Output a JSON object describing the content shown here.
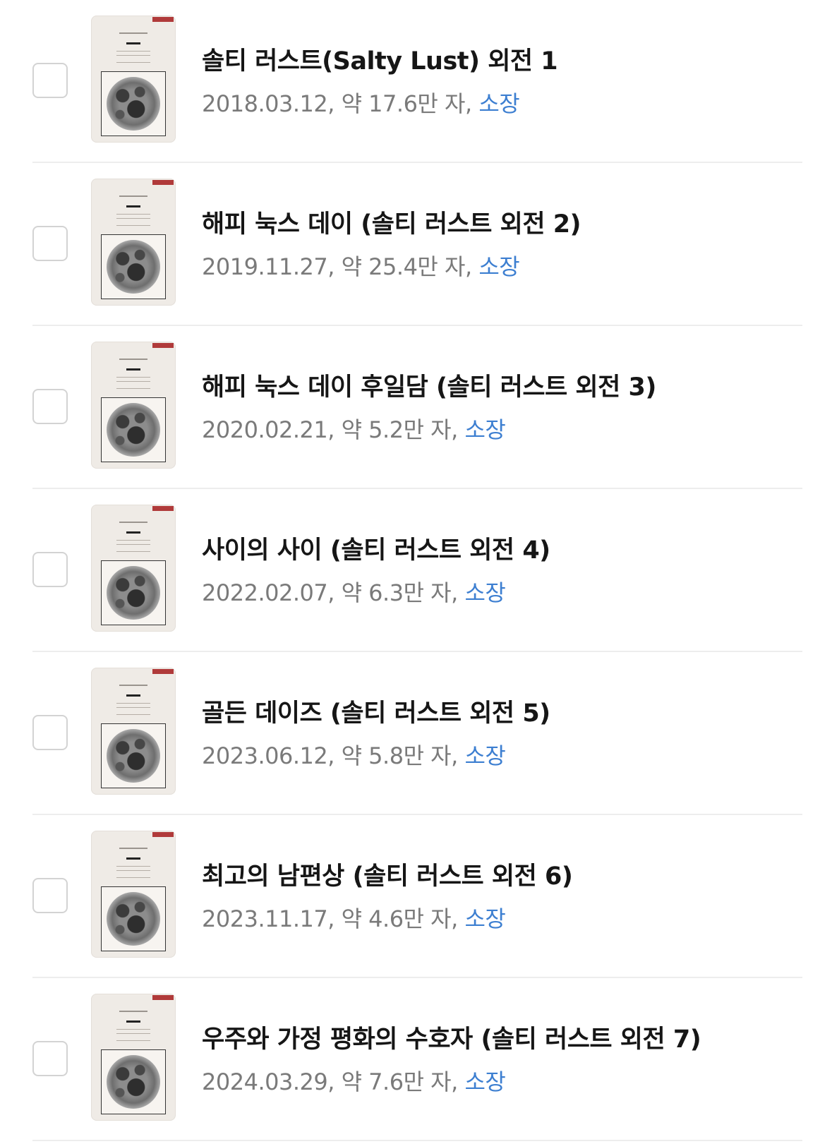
{
  "books": [
    {
      "title": "솔티 러스트(Salty Lust) 외전 1",
      "date": "2018.03.12",
      "length": "약 17.6만 자",
      "status": "소장"
    },
    {
      "title": "해피 눅스 데이 (솔티 러스트 외전 2)",
      "date": "2019.11.27",
      "length": "약 25.4만 자",
      "status": "소장"
    },
    {
      "title": "해피 눅스 데이 후일담 (솔티 러스트 외전 3)",
      "date": "2020.02.21",
      "length": "약 5.2만 자",
      "status": "소장"
    },
    {
      "title": "사이의 사이 (솔티 러스트 외전 4)",
      "date": "2022.02.07",
      "length": "약 6.3만 자",
      "status": "소장"
    },
    {
      "title": "골든 데이즈 (솔티 러스트 외전 5)",
      "date": "2023.06.12",
      "length": "약 5.8만 자",
      "status": "소장"
    },
    {
      "title": "최고의 남편상 (솔티 러스트 외전 6)",
      "date": "2023.11.17",
      "length": "약 4.6만 자",
      "status": "소장"
    },
    {
      "title": "우주와 가정 평화의 수호자 (솔티 러스트 외전 7)",
      "date": "2024.03.29",
      "length": "약 7.6만 자",
      "status": "소장"
    }
  ],
  "separator": ", ",
  "colors": {
    "owned_link": "#3d7fd1",
    "meta_text": "#7a7a7a",
    "divider": "#ededed",
    "checkbox_border": "#d3d3d3"
  }
}
